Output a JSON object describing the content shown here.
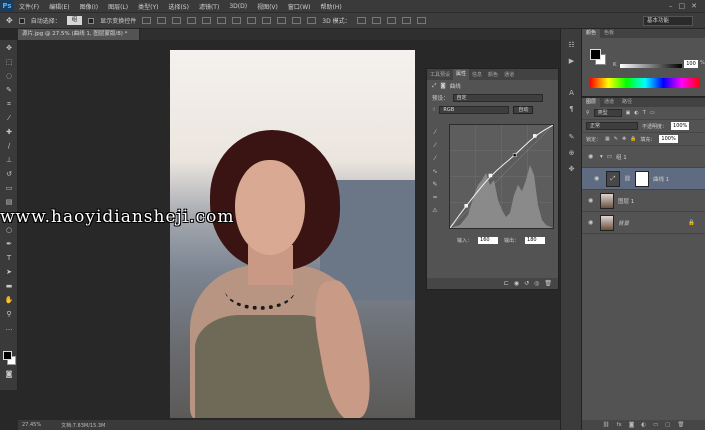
{
  "app": {
    "logo": "Ps",
    "menu": [
      "文件(F)",
      "编辑(E)",
      "图像(I)",
      "图层(L)",
      "类型(Y)",
      "选择(S)",
      "滤镜(T)",
      "3D(D)",
      "视图(V)",
      "窗口(W)",
      "帮助(H)"
    ],
    "window_buttons": [
      "–",
      "□",
      "✕"
    ]
  },
  "options_bar": {
    "auto_select_label": "自动选择：",
    "auto_select_value": "组",
    "show_transform_label": "显示变换控件",
    "mode_3d_label": "3D 模式："
  },
  "workspace": "基本功能",
  "document": {
    "tab_title": "源片.jpg @ 27.5% (曲线 1, 图层蒙版/8) *"
  },
  "watermark": "www.haoyidiansheji.com",
  "status": {
    "zoom": "27.45%",
    "doc_size": "文档:7.83M/15.3M"
  },
  "properties": {
    "tabs": [
      "工具预设",
      "属性",
      "信息",
      "颜色",
      "通道"
    ],
    "active_tab": "属性",
    "panel_title": "曲线",
    "preset_label": "预设：",
    "preset_value": "自定",
    "channel_value": "RGB",
    "auto_label": "自动",
    "input_label": "输入：",
    "input_value": "160",
    "output_label": "输出：",
    "output_value": "180",
    "footer_icons": [
      "clip-icon",
      "view-previous-icon",
      "reset-icon",
      "visibility-icon",
      "delete-icon"
    ]
  },
  "color_panel": {
    "tabs": [
      "颜色",
      "色板"
    ],
    "active_tab": "颜色",
    "channel": "K",
    "value": "100",
    "unit": "%"
  },
  "layers_panel": {
    "tabs": [
      "图层",
      "通道",
      "路径"
    ],
    "active_tab": "图层",
    "kind_label": "类型",
    "blend_mode": "正常",
    "opacity_label": "不透明度：",
    "opacity": "100%",
    "lock_label": "锁定：",
    "fill_label": "填充：",
    "fill": "100%",
    "layers": [
      {
        "name": "组 1",
        "type": "group"
      },
      {
        "name": "曲线 1",
        "type": "adjustment"
      },
      {
        "name": "图层 1",
        "type": "pixel"
      },
      {
        "name": "背景",
        "type": "background"
      }
    ]
  },
  "chart_data": {
    "type": "line",
    "series": [
      {
        "values": [
          [
            0,
            0
          ],
          [
            40,
            55
          ],
          [
            100,
            130
          ],
          [
            160,
            180
          ],
          [
            210,
            228
          ],
          [
            255,
            255
          ]
        ]
      }
    ],
    "xlim": [
      0,
      255
    ],
    "ylim": [
      0,
      255
    ]
  }
}
